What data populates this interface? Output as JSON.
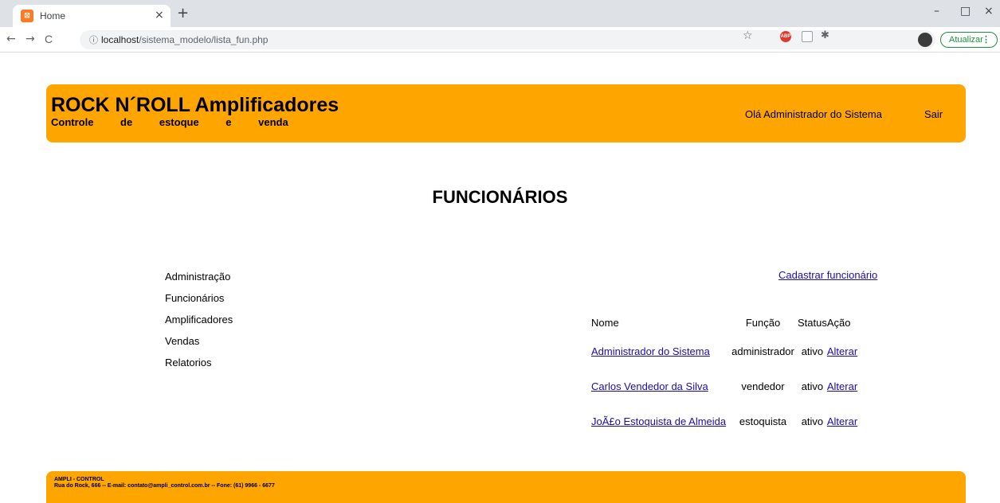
{
  "browser": {
    "tab_title": "Home",
    "tab_close": "×",
    "new_tab": "+",
    "url_host": "localhost",
    "url_path": "/sistema_modelo/lista_fun.php",
    "update_label": "Atualizar",
    "update_menu": "⋮",
    "back": "←",
    "forward": "→",
    "reload": "C",
    "minimize": "–",
    "maximize": "□",
    "close": "×",
    "star": "☆",
    "info": "ⓘ",
    "extension_abp": "ABP",
    "puzzle": "✱"
  },
  "header": {
    "title": "ROCK N´ROLL Amplificadores",
    "subtitle": "Controle de estoque e venda",
    "greeting": "Olá Administrador do Sistema",
    "logout": "Sair"
  },
  "page": {
    "heading": "FUNCIONÁRIOS",
    "register_link": "Cadastrar funcionário"
  },
  "menu": {
    "items": [
      "Administração",
      "Funcionários",
      "Amplificadores",
      "Vendas",
      "Relatorios"
    ]
  },
  "table": {
    "headers": {
      "name": "Nome",
      "function": "Função",
      "status": "Status",
      "action": "Ação"
    },
    "rows": [
      {
        "name": "Administrador do Sistema",
        "function": "administrador",
        "status": "ativo",
        "action": "Alterar"
      },
      {
        "name": "Carlos Vendedor da Silva",
        "function": "vendedor",
        "status": "ativo",
        "action": "Alterar"
      },
      {
        "name": "JoÃ£o Estoquista de Almeida",
        "function": "estoquista",
        "status": "ativo",
        "action": "Alterar"
      }
    ]
  },
  "footer": {
    "brand": "AMPLI - CONTROL",
    "info": "Rua do Rock, 666 -- E-mail: contato@ampli_control.com.br -- Fone: (61) 9966 - 6677"
  },
  "colors": {
    "accent": "#ffa500",
    "link": "#1a0dab"
  }
}
